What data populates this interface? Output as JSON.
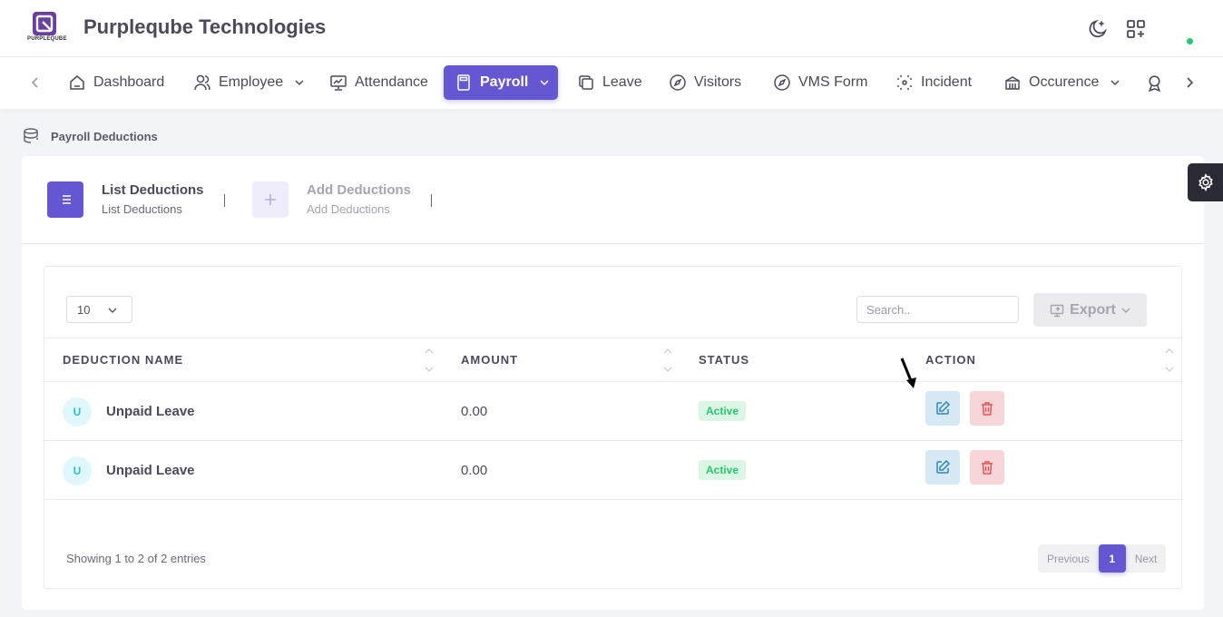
{
  "brand": {
    "logo_text": "PURPLEQUBE",
    "name": "Purpleqube Technologies"
  },
  "header": {
    "theme_icon": "moon-icon",
    "apps_icon": "grid-plus-icon"
  },
  "nav": {
    "items": [
      {
        "label": "Dashboard",
        "icon": "home-icon"
      },
      {
        "label": "Employee",
        "icon": "users-icon",
        "dropdown": true
      },
      {
        "label": "Attendance",
        "icon": "presentation-icon"
      },
      {
        "label": "Payroll",
        "icon": "calculator-icon",
        "dropdown": true,
        "active": true
      },
      {
        "label": "Leave",
        "icon": "copy-icon"
      },
      {
        "label": "Visitors",
        "icon": "compass-icon"
      },
      {
        "label": "VMS Form",
        "icon": "compass-icon"
      },
      {
        "label": "Incident",
        "icon": "focus-icon"
      },
      {
        "label": "Occurence",
        "icon": "building-icon",
        "dropdown": true
      }
    ]
  },
  "breadcrumb": {
    "label": "Payroll Deductions"
  },
  "tabs": [
    {
      "title": "List Deductions",
      "subtitle": "List Deductions",
      "active": true
    },
    {
      "title": "Add Deductions",
      "subtitle": "Add Deductions",
      "active": false
    }
  ],
  "table_controls": {
    "page_length": "10",
    "search_placeholder": "Search..",
    "export_label": "Export"
  },
  "table": {
    "columns": [
      "DEDUCTION NAME",
      "AMOUNT",
      "STATUS",
      "ACTION"
    ],
    "rows": [
      {
        "initial": "U",
        "name": "Unpaid Leave",
        "amount": "0.00",
        "status": "Active"
      },
      {
        "initial": "U",
        "name": "Unpaid Leave",
        "amount": "0.00",
        "status": "Active"
      }
    ]
  },
  "footer": {
    "info": "Showing 1 to 2 of 2 entries",
    "previous": "Previous",
    "page": "1",
    "next": "Next"
  },
  "colors": {
    "primary": "#6557d2",
    "success": "#28c76f",
    "danger": "#ea5455",
    "info": "#27c0d8"
  }
}
